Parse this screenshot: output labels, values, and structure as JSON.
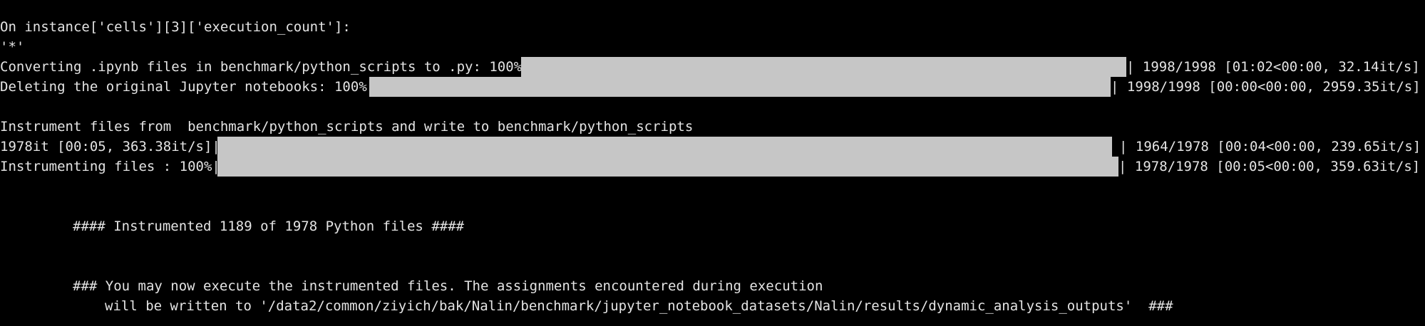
{
  "terminal": {
    "line_1": "On instance['cells'][3]['execution_count']:",
    "line_2": "'*'",
    "progress_convert": {
      "prefix": "Converting .ipynb files in benchmark/python_scripts to .py: 100%|",
      "suffix": "| 1998/1998 [01:02<00:00, 32.14it/s]",
      "progress": 1.0
    },
    "progress_delete": {
      "prefix": "Deleting the original Jupyter notebooks: 100%|",
      "suffix": "| 1998/1998 [00:00<00:00, 2959.35it/s]",
      "progress": 1.0
    },
    "instrument_header": "Instrument files from  benchmark/python_scripts and write to benchmark/python_scripts",
    "progress_iter": {
      "prefix": "1978it [00:05, 363.38it/s]|",
      "suffix": "| 1964/1978 [00:04<00:00, 239.65it/s]",
      "progress": 0.993
    },
    "progress_instrument": {
      "prefix": "Instrumenting files : 100%|",
      "suffix": "| 1978/1978 [00:05<00:00, 359.63it/s]",
      "progress": 1.0
    },
    "summary": "#### Instrumented 1189 of 1978 Python files ####",
    "notice_line_1": "### You may now execute the instrumented files. The assignments encountered during execution",
    "notice_line_2": "will be written to '/data2/common/ziyich/bak/Nalin/benchmark/jupyter_notebook_datasets/Nalin/results/dynamic_analysis_outputs'  ###"
  },
  "colors": {
    "background": "#000000",
    "text": "#e4e4e4",
    "bar_fill": "#c6c6c6"
  }
}
